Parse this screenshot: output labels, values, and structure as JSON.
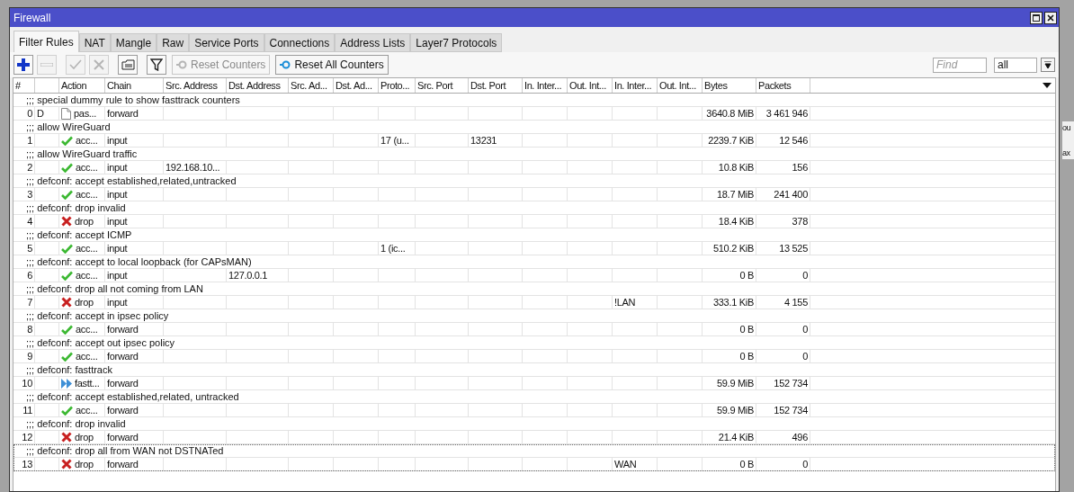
{
  "window": {
    "title": "Firewall"
  },
  "tabs": [
    {
      "label": "Filter Rules",
      "selected": true
    },
    {
      "label": "NAT",
      "selected": false
    },
    {
      "label": "Mangle",
      "selected": false
    },
    {
      "label": "Raw",
      "selected": false
    },
    {
      "label": "Service Ports",
      "selected": false
    },
    {
      "label": "Connections",
      "selected": false
    },
    {
      "label": "Address Lists",
      "selected": false
    },
    {
      "label": "Layer7 Protocols",
      "selected": false
    }
  ],
  "toolbar": {
    "icon_buttons": [
      {
        "kind": "add",
        "disabled": false
      },
      {
        "kind": "remove",
        "disabled": true
      },
      {
        "kind": "enable",
        "disabled": true
      },
      {
        "kind": "disable",
        "disabled": true
      },
      {
        "kind": "comment",
        "disabled": false
      },
      {
        "kind": "filter",
        "disabled": false
      }
    ],
    "text_buttons": [
      {
        "label": "Reset Counters",
        "disabled": true
      },
      {
        "label": "Reset All Counters",
        "disabled": false
      }
    ],
    "search": {
      "placeholder": "Find"
    },
    "scope": {
      "value": "all"
    }
  },
  "table": {
    "columns": [
      "#",
      "Action",
      "Chain",
      "Src. Address",
      "Dst. Address",
      "Src. Ad...",
      "Dst. Ad...",
      "Proto...",
      "Src. Port",
      "Dst. Port",
      "In. Inter...",
      "Out. Int...",
      "In. Inter...",
      "Out. Int...",
      "Bytes",
      "Packets"
    ],
    "rows": [
      {
        "comment": ";;; special dummy rule to show fasttrack counters",
        "number": "0",
        "flag": "D",
        "kind": "passthrough",
        "action": "pas...",
        "chain": "forward",
        "bytes": "3640.8 MiB",
        "packets": "3 461 946",
        "selected": false
      },
      {
        "comment": ";;; allow WireGuard",
        "number": "1",
        "kind": "accept",
        "action": "acc...",
        "chain": "input",
        "protocol": "17 (u...",
        "dst_port": "13231",
        "bytes": "2239.7 KiB",
        "packets": "12 546",
        "selected": false
      },
      {
        "comment": ";;; allow WireGuard traffic",
        "number": "2",
        "kind": "accept",
        "action": "acc...",
        "chain": "input",
        "src_address": "192.168.10...",
        "bytes": "10.8 KiB",
        "packets": "156",
        "selected": false
      },
      {
        "comment": ";;; defconf: accept established,related,untracked",
        "number": "3",
        "kind": "accept",
        "action": "acc...",
        "chain": "input",
        "bytes": "18.7 MiB",
        "packets": "241 400",
        "selected": false
      },
      {
        "comment": ";;; defconf: drop invalid",
        "number": "4",
        "kind": "drop",
        "action": "drop",
        "chain": "input",
        "bytes": "18.4 KiB",
        "packets": "378",
        "selected": false
      },
      {
        "comment": ";;; defconf: accept ICMP",
        "number": "5",
        "kind": "accept",
        "action": "acc...",
        "chain": "input",
        "protocol": "1 (ic...",
        "bytes": "510.2 KiB",
        "packets": "13 525",
        "selected": false
      },
      {
        "comment": ";;; defconf: accept to local loopback (for CAPsMAN)",
        "number": "6",
        "kind": "accept",
        "action": "acc...",
        "chain": "input",
        "dst_address": "127.0.0.1",
        "bytes": "0 B",
        "packets": "0",
        "selected": false
      },
      {
        "comment": ";;; defconf: drop all not coming from LAN",
        "number": "7",
        "kind": "drop",
        "action": "drop",
        "chain": "input",
        "in_interface_list": "!LAN",
        "bytes": "333.1 KiB",
        "packets": "4 155",
        "selected": false
      },
      {
        "comment": ";;; defconf: accept in ipsec policy",
        "number": "8",
        "kind": "accept",
        "action": "acc...",
        "chain": "forward",
        "bytes": "0 B",
        "packets": "0",
        "selected": false
      },
      {
        "comment": ";;; defconf: accept out ipsec policy",
        "number": "9",
        "kind": "accept",
        "action": "acc...",
        "chain": "forward",
        "bytes": "0 B",
        "packets": "0",
        "selected": false
      },
      {
        "comment": ";;; defconf: fasttrack",
        "number": "10",
        "kind": "fasttrack",
        "action": "fastt...",
        "chain": "forward",
        "bytes": "59.9 MiB",
        "packets": "152 734",
        "selected": false
      },
      {
        "comment": ";;; defconf: accept established,related, untracked",
        "number": "11",
        "kind": "accept",
        "action": "acc...",
        "chain": "forward",
        "bytes": "59.9 MiB",
        "packets": "152 734",
        "selected": false
      },
      {
        "comment": ";;; defconf: drop invalid",
        "number": "12",
        "kind": "drop",
        "action": "drop",
        "chain": "forward",
        "bytes": "21.4 KiB",
        "packets": "496",
        "selected": false
      },
      {
        "comment": ";;; defconf: drop all from WAN not DSTNATed",
        "number": "13",
        "kind": "drop",
        "action": "drop",
        "chain": "forward",
        "in_interface_list": "WAN",
        "bytes": "0 B",
        "packets": "0",
        "selected": true
      }
    ]
  },
  "background_window": {
    "texts": [
      "ou",
      "ax"
    ]
  }
}
